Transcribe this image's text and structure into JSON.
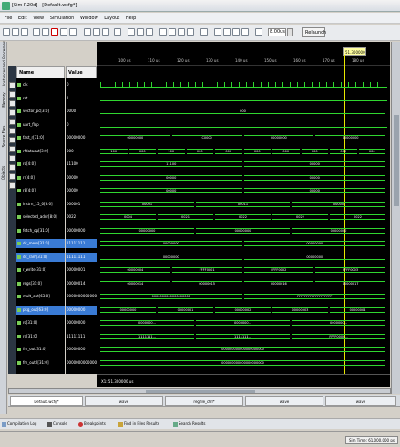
{
  "window": {
    "title": "[Sim P.20d] - [Default.wcfg*]"
  },
  "menu": [
    "File",
    "Edit",
    "View",
    "Simulation",
    "Window",
    "Layout",
    "Help"
  ],
  "toolbar": {
    "zoom_value": "8.00us",
    "relaunch_label": "Relaunch"
  },
  "left_tabs": [
    "Instances and Processes",
    "Memory",
    "Source Files",
    "Objects"
  ],
  "columns": {
    "name": "Name",
    "value": "Value"
  },
  "ruler": {
    "ticks": [
      "100 us",
      "110 us",
      "120 us",
      "130 us",
      "140 us",
      "150 us",
      "160 us",
      "170 us",
      "180 us"
    ],
    "cursor_label": "51.300000 us"
  },
  "signals": [
    {
      "name": "clk",
      "value": "0"
    },
    {
      "name": "rst",
      "value": "1"
    },
    {
      "name": "vector_pc[3:0]",
      "value": "0000"
    },
    {
      "name": "uart_flop",
      "value": "0"
    },
    {
      "name": "fast_r[31:0]",
      "value": "00000000"
    },
    {
      "name": "rfdataout[3:0]",
      "value": "000"
    },
    {
      "name": "rq[4:0]",
      "value": "11100"
    },
    {
      "name": "rr[4:0]",
      "value": "00000"
    },
    {
      "name": "r8[4:0]",
      "value": "00000"
    },
    {
      "name": "instrn_15_0[8:0]",
      "value": "000001"
    },
    {
      "name": "selected_addr[8:0]",
      "value": "0022"
    },
    {
      "name": "fetch_op[31:0]",
      "value": "00000000"
    },
    {
      "name": "dc_mem[31:0]",
      "value": "11111111"
    },
    {
      "name": "dc_ram[31:0]",
      "value": "11111111"
    },
    {
      "name": "r_write[31:0]",
      "value": "00000001"
    },
    {
      "name": "regs[31:0]",
      "value": "00000014"
    },
    {
      "name": "mult_out[63:0]",
      "value": "0000000000000000"
    },
    {
      "name": "pkg_out[63:0]",
      "value": "00000000"
    },
    {
      "name": "rc[31:0]",
      "value": "00000000"
    },
    {
      "name": "rd[31:0]",
      "value": "11111111"
    },
    {
      "name": "fm_out[31:0]",
      "value": "00000000"
    },
    {
      "name": "fm_out2[31:0]",
      "value": "0000000000000000"
    }
  ],
  "waves": {
    "vector_pc": [
      "000"
    ],
    "fast_r": [
      "00000000",
      "C0000",
      "00000000",
      "00000000"
    ],
    "rfdataout": [
      "100",
      "000",
      "100",
      "000",
      "000",
      "000",
      "000",
      "000",
      "000",
      "000"
    ],
    "rq": [
      "11100",
      "00000"
    ],
    "rr": [
      "00000",
      "00000"
    ],
    "r8": [
      "00000",
      "00000"
    ],
    "instrn": [
      "00001",
      "00011",
      "00000"
    ],
    "selected_addr": [
      "0004",
      "0021",
      "0022",
      "0022",
      "0022"
    ],
    "fetch_op": [
      "00000000",
      "00000000",
      "00000000"
    ],
    "dc_mem": [
      "00000000",
      "00000000"
    ],
    "dc_ram": [
      "00000000",
      "00000000"
    ],
    "r_write": [
      "00000004",
      "FFFF0001",
      "FFFF0002",
      "FFFF0003"
    ],
    "regs": [
      "00000014",
      "00000015",
      "00000016",
      "00000017"
    ],
    "mult_out": [
      "0000000000000000000",
      "FFFFFFFFFFFFFFFFFFF"
    ],
    "pkg_out": [
      "00000000",
      "00000001",
      "00000002",
      "00000003",
      "00000004"
    ],
    "rc": [
      "0000000...",
      "0000000...",
      "0000000..."
    ],
    "rd": [
      "1111111...",
      "1111111...",
      "FFFF0000..."
    ],
    "fm_out": [
      "000000000000000000000"
    ],
    "fm_out2": [
      "000000000000000000000"
    ]
  },
  "timestamp": "X1: 51.300000 us",
  "doc_tabs": [
    "Default.wcfg*",
    "wave",
    "regfile_ctrl*",
    "wave",
    "wave"
  ],
  "bottom_tabs": [
    "Compilation Log",
    "Console",
    "Breakpoints",
    "Find in Files Results",
    "Search Results"
  ],
  "status": {
    "sim_time": "Sim Time: 61,000,000 ps"
  }
}
